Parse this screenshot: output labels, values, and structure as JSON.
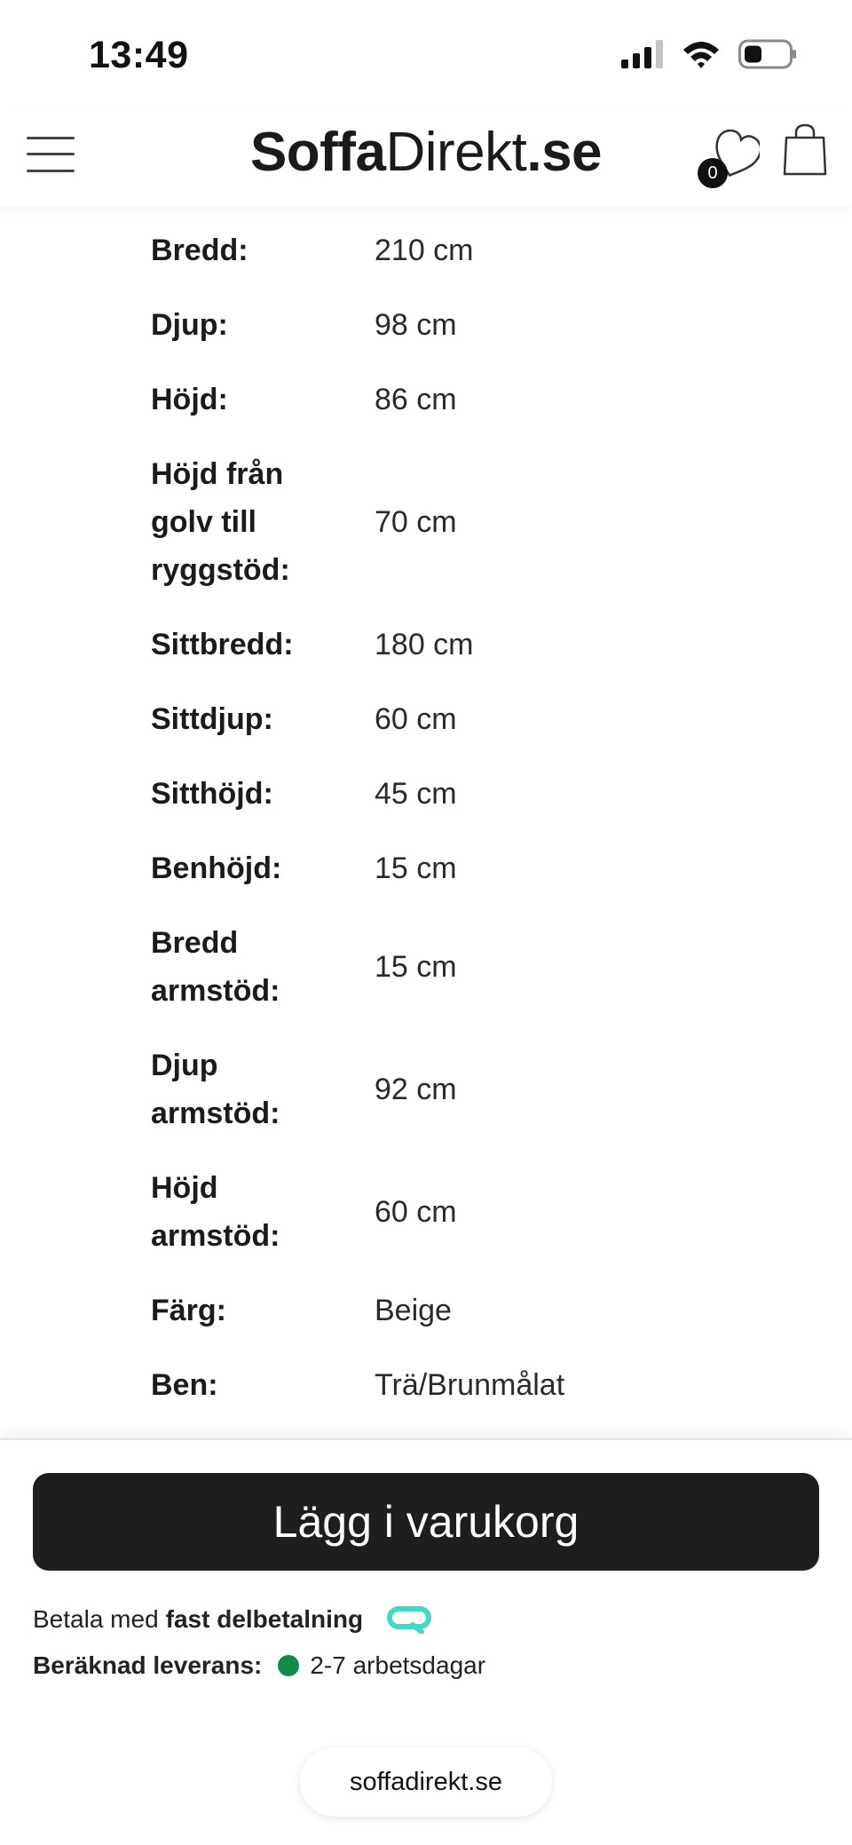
{
  "status_bar": {
    "time": "13:49",
    "icons": [
      "cellular-signal-icon",
      "wifi-icon",
      "battery-icon"
    ]
  },
  "header": {
    "logo_bold": "Soffa",
    "logo_light": "Direkt",
    "logo_suffix": ".se",
    "wishlist_count": "0",
    "icons": [
      "menu-icon",
      "heart-icon",
      "shopping-bag-icon"
    ]
  },
  "specs": [
    {
      "label": "Bredd:",
      "value": "210 cm"
    },
    {
      "label": "Djup:",
      "value": "98 cm"
    },
    {
      "label": "Höjd:",
      "value": "86 cm"
    },
    {
      "label": "Höjd från golv till ryggstöd:",
      "value": "70 cm"
    },
    {
      "label": "Sittbredd:",
      "value": "180 cm"
    },
    {
      "label": "Sittdjup:",
      "value": "60 cm"
    },
    {
      "label": "Sitthöjd:",
      "value": "45 cm"
    },
    {
      "label": "Benhöjd:",
      "value": "15 cm"
    },
    {
      "label": "Bredd armstöd:",
      "value": "15 cm"
    },
    {
      "label": "Djup armstöd:",
      "value": "92 cm"
    },
    {
      "label": "Höjd armstöd:",
      "value": "60 cm"
    },
    {
      "label": "Färg:",
      "value": "Beige"
    },
    {
      "label": "Ben:",
      "value": "Trä/Brunmålat"
    }
  ],
  "cart": {
    "add_label": "Lägg i varukorg",
    "pay_prefix": "Betala med",
    "pay_method": "fast delbetalning",
    "delivery_label": "Beräknad leverans:",
    "delivery_value": "2-7 arbetsdagar",
    "delivery_status_color": "#138a4a"
  },
  "browser": {
    "url": "soffadirekt.se"
  },
  "colors": {
    "button_bg": "#1e1e1e",
    "payment_logo": "#3fd9c4"
  }
}
